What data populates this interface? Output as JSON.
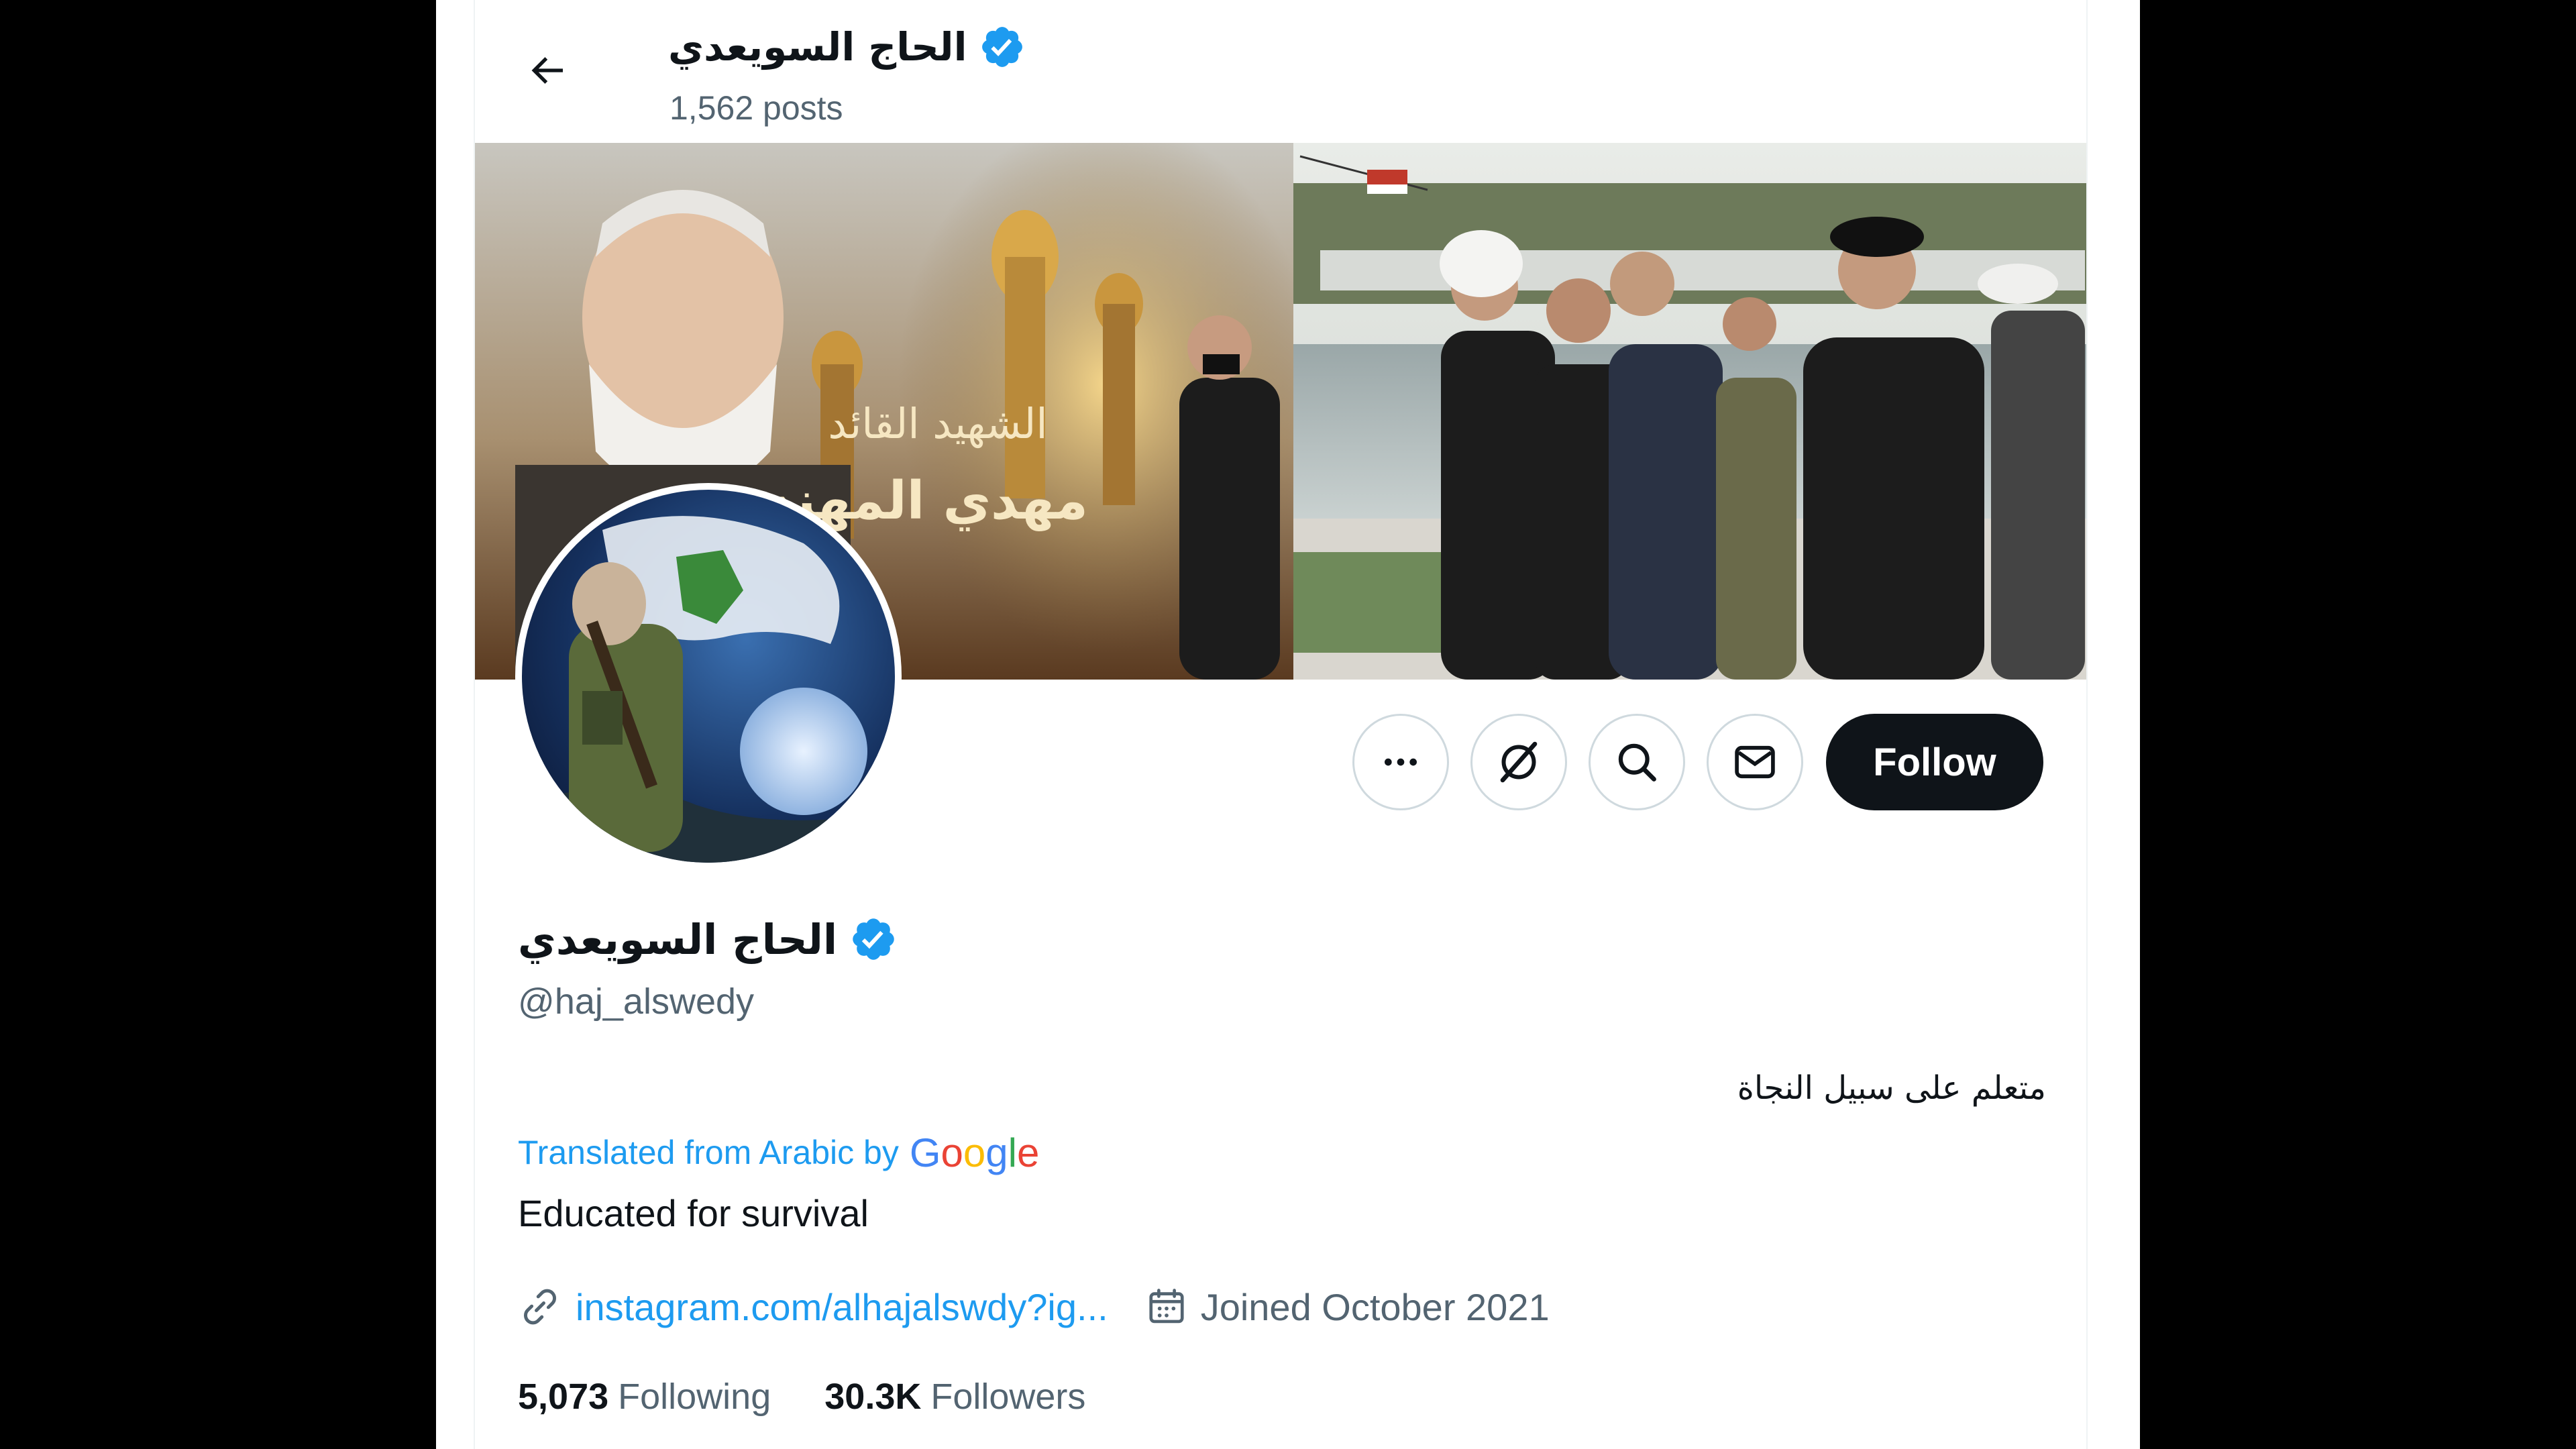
{
  "header": {
    "display_name": "الحاج السويعدي",
    "post_count": "1,562 posts"
  },
  "banner": {
    "arabic_text_line1": "الشهيد القائد",
    "arabic_text_line2": "مهدي المهندس"
  },
  "actions": {
    "more_icon": "more-dots-icon",
    "grok_icon": "grok-slash-icon",
    "search_icon": "search-icon",
    "message_icon": "envelope-icon",
    "follow_label": "Follow"
  },
  "profile": {
    "name": "الحاج السويعدي",
    "handle": "@haj_alswedy",
    "bio_original": "متعلم على سبيل النجاة",
    "translated_prefix": "Translated from Arabic by",
    "google_letters": [
      "G",
      "o",
      "o",
      "g",
      "l",
      "e"
    ],
    "bio_translated": "Educated for survival",
    "link": "instagram.com/alhajalswdy?ig...",
    "joined": "Joined October 2021"
  },
  "stats": {
    "following_count": "5,073",
    "following_label": "Following",
    "followers_count": "30.3K",
    "followers_label": "Followers"
  },
  "colors": {
    "verified": "#1d9bf0",
    "link": "#1d9bf0",
    "secondary_text": "#536471",
    "primary_text": "#0f1419",
    "google_blue": "#4285f4",
    "google_red": "#ea4335",
    "google_yellow": "#fbbc05",
    "google_green": "#34a853"
  }
}
